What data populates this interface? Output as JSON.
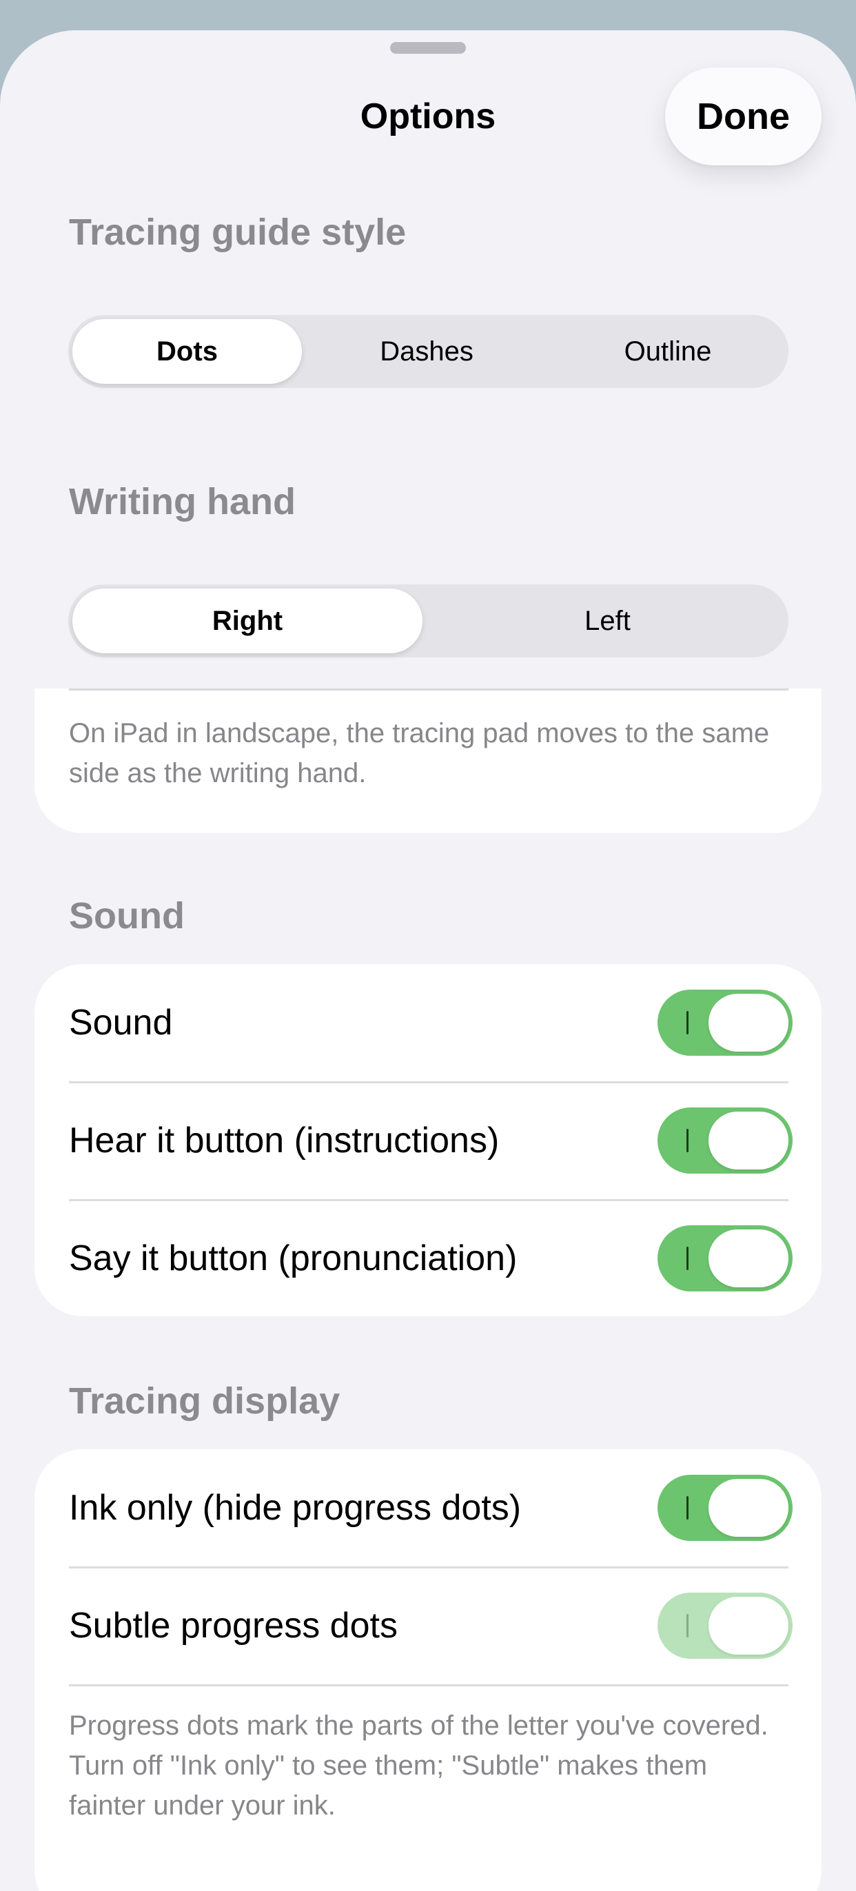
{
  "nav": {
    "title": "Options",
    "done_label": "Done"
  },
  "tracing_guide": {
    "header": "Tracing guide style",
    "options": [
      "Dots",
      "Dashes",
      "Outline"
    ],
    "selected": "Dots"
  },
  "writing_hand": {
    "header": "Writing hand",
    "options": [
      "Right",
      "Left"
    ],
    "selected": "Right",
    "footnote": "On iPad in landscape, the tracing pad moves to the same side as the writing hand."
  },
  "sound": {
    "header": "Sound",
    "rows": [
      {
        "label": "Sound",
        "on": true
      },
      {
        "label": "Hear it button (instructions)",
        "on": true
      },
      {
        "label": "Say it button (pronunciation)",
        "on": true
      }
    ]
  },
  "tracing_display": {
    "header": "Tracing display",
    "rows": [
      {
        "label": "Ink only (hide progress dots)",
        "on": true
      },
      {
        "label": "Subtle progress dots",
        "on": true,
        "disabled": true
      }
    ],
    "footnote": "Progress dots mark the parts of the letter you've covered. Turn off \"Ink only\" to see them; \"Subtle\" makes them fainter under your ink."
  },
  "colors": {
    "accent_green": "#6cc46e",
    "background": "#f2f2f7"
  }
}
